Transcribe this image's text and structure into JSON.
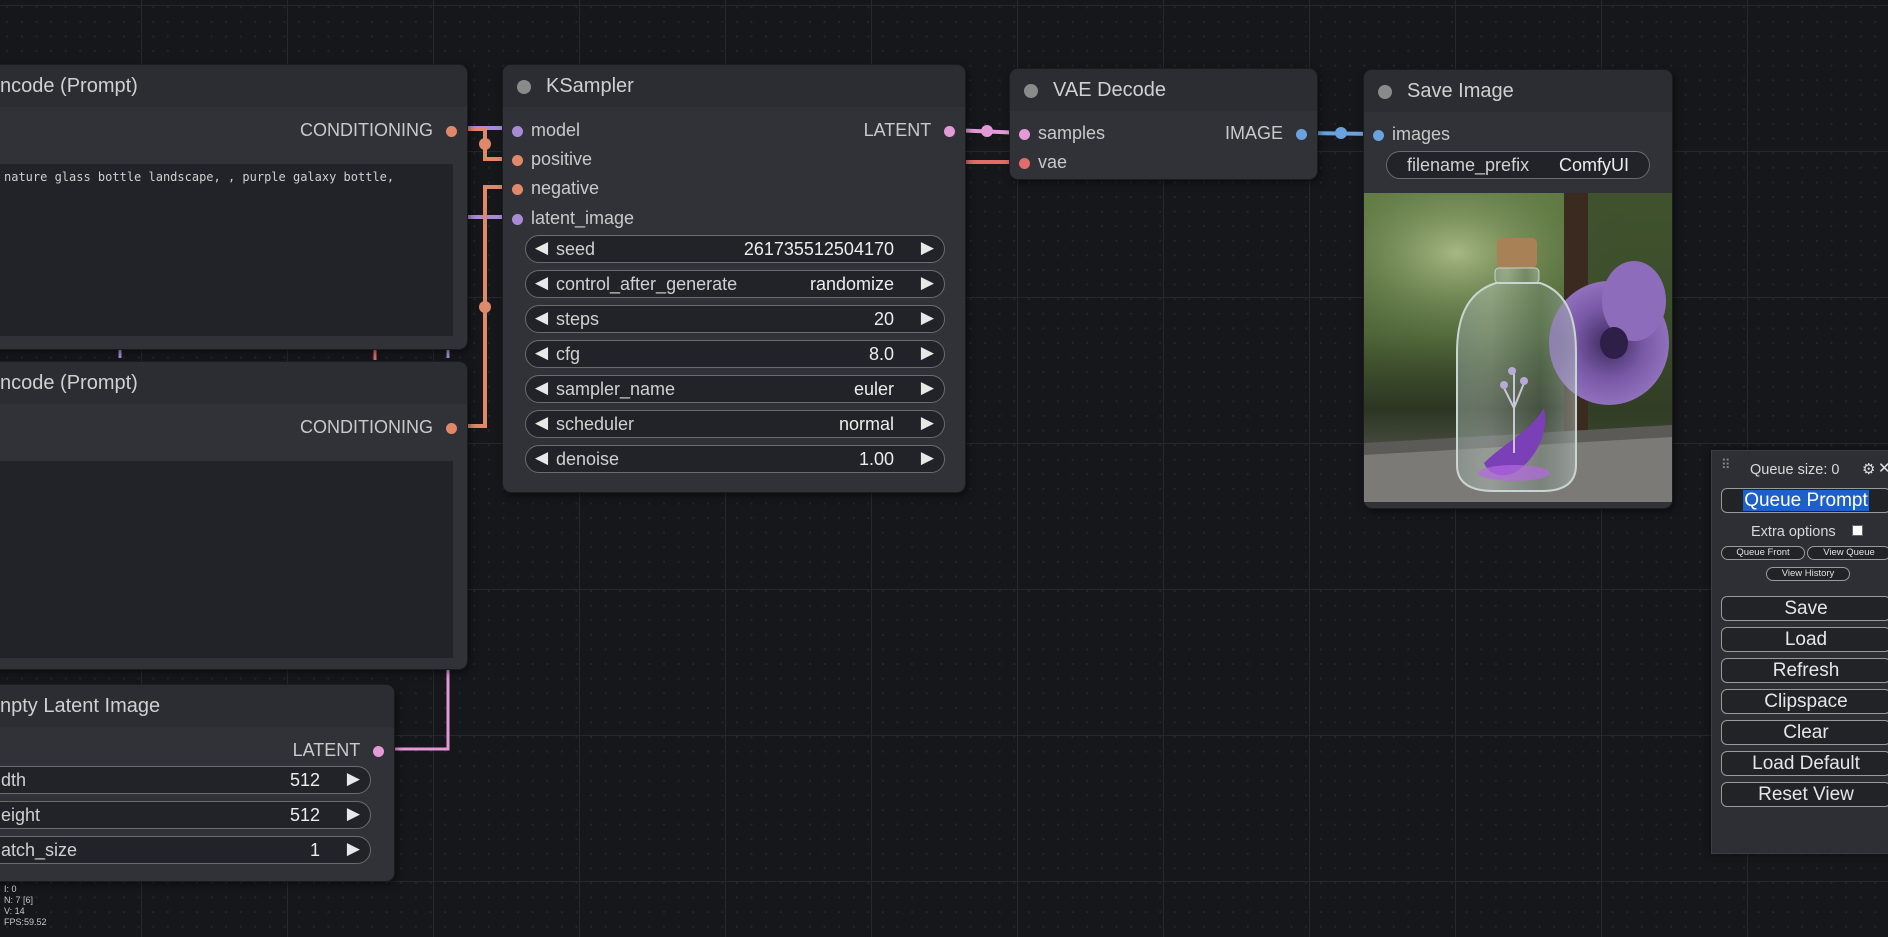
{
  "colors": {
    "conditioning": "#e0896a",
    "model": "#a88bd6",
    "latent": "#e59ad8",
    "vae": "#e26b6b",
    "image": "#6aa2e0",
    "canvas_bg": "#16171b",
    "node_bg": "#303238"
  },
  "nodes": {
    "clip_pos": {
      "title": "ncode (Prompt)",
      "output": "CONDITIONING",
      "text": "nature glass bottle landscape, , purple galaxy bottle,"
    },
    "clip_neg": {
      "title": "ncode (Prompt)",
      "output": "CONDITIONING",
      "text": ""
    },
    "empty_latent": {
      "title": "npty Latent Image",
      "output": "LATENT",
      "widgets": [
        {
          "label": "dth",
          "value": "512"
        },
        {
          "label": "eight",
          "value": "512"
        },
        {
          "label": "atch_size",
          "value": "1"
        }
      ]
    },
    "ksampler": {
      "title": "KSampler",
      "inputs": [
        "model",
        "positive",
        "negative",
        "latent_image"
      ],
      "output": "LATENT",
      "widgets": [
        {
          "label": "seed",
          "value": "261735512504170"
        },
        {
          "label": "control_after_generate",
          "value": "randomize"
        },
        {
          "label": "steps",
          "value": "20"
        },
        {
          "label": "cfg",
          "value": "8.0"
        },
        {
          "label": "sampler_name",
          "value": "euler"
        },
        {
          "label": "scheduler",
          "value": "normal"
        },
        {
          "label": "denoise",
          "value": "1.00"
        }
      ]
    },
    "vae_decode": {
      "title": "VAE Decode",
      "inputs": [
        "samples",
        "vae"
      ],
      "output": "IMAGE"
    },
    "save_image": {
      "title": "Save Image",
      "input": "images",
      "widget": {
        "label": "filename_prefix",
        "value": "ComfyUI"
      },
      "image_icon": "glass-bottle-with-purple-flower-image"
    }
  },
  "menu": {
    "queue_size": "Queue size: 0",
    "queue_prompt": "Queue Prompt",
    "extra_options": "Extra options",
    "queue_front": "Queue Front",
    "view_queue": "View Queue",
    "view_history": "View History",
    "buttons": [
      "Save",
      "Load",
      "Refresh",
      "Clipspace",
      "Clear",
      "Load Default",
      "Reset View"
    ],
    "drag_icon": "drag-handle-icon",
    "settings_icon": "gear-icon",
    "close_icon": "close-icon"
  },
  "stats": {
    "i": "I: 0",
    "n": "N: 7 [6]",
    "v": "V: 14",
    "fps": "FPS:59.52"
  }
}
